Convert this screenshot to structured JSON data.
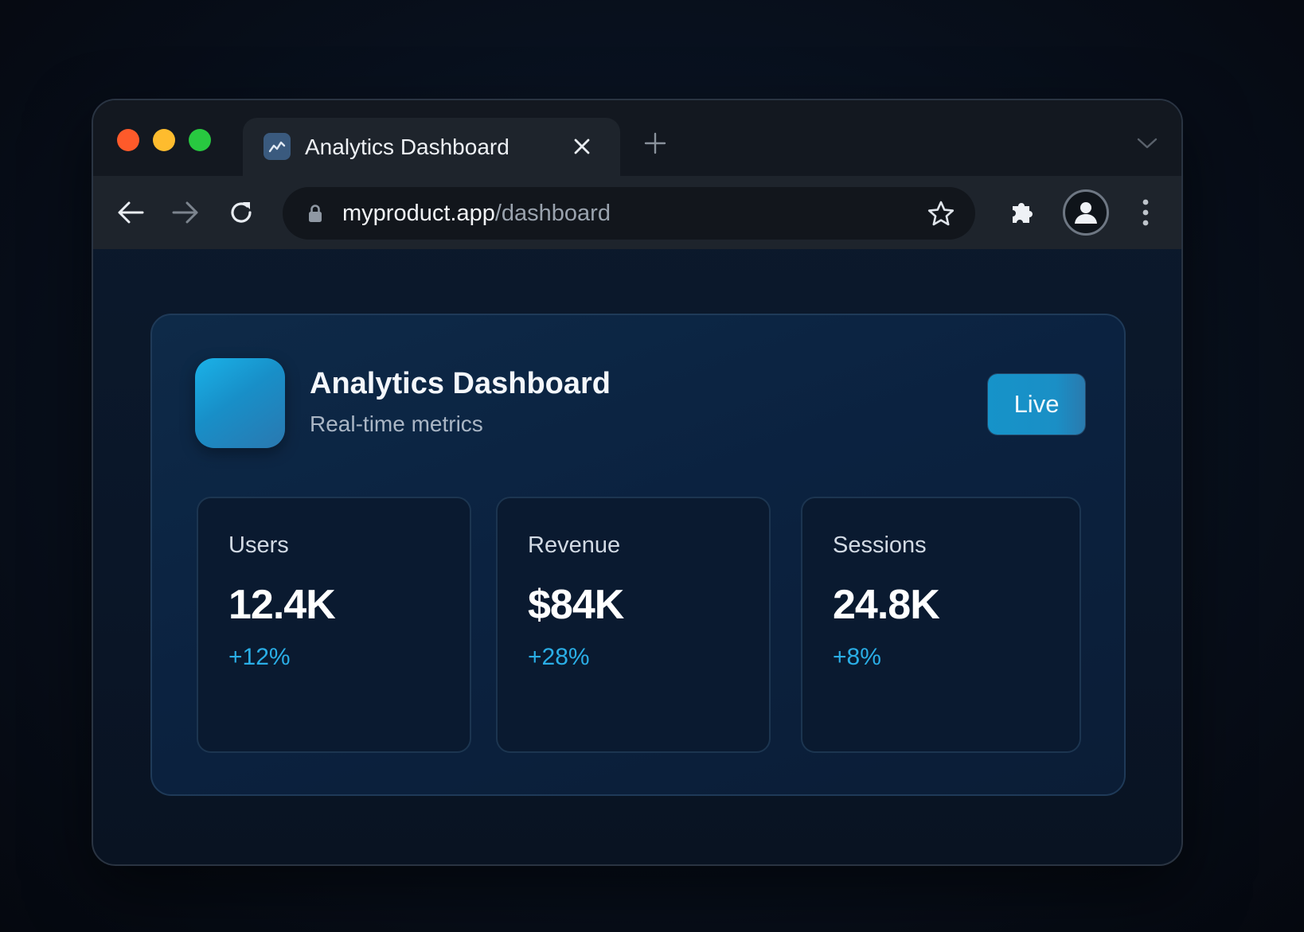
{
  "browser": {
    "tab": {
      "title": "Analytics Dashboard",
      "favicon": "chart-icon"
    },
    "address_bar": {
      "host": "myproduct.app",
      "path": "/dashboard"
    }
  },
  "dashboard": {
    "title": "Analytics Dashboard",
    "subtitle": "Real-time metrics",
    "status_badge": "Live",
    "metrics": [
      {
        "label": "Users",
        "value": "12.4K",
        "change": "+12%"
      },
      {
        "label": "Revenue",
        "value": "$84K",
        "change": "+28%"
      },
      {
        "label": "Sessions",
        "value": "24.8K",
        "change": "+8%"
      }
    ]
  },
  "colors": {
    "accent": "#2aaee6",
    "badge": "#1693c9",
    "traffic_red": "#fe5a2a",
    "traffic_yellow": "#febc2e",
    "traffic_green": "#28c840"
  }
}
